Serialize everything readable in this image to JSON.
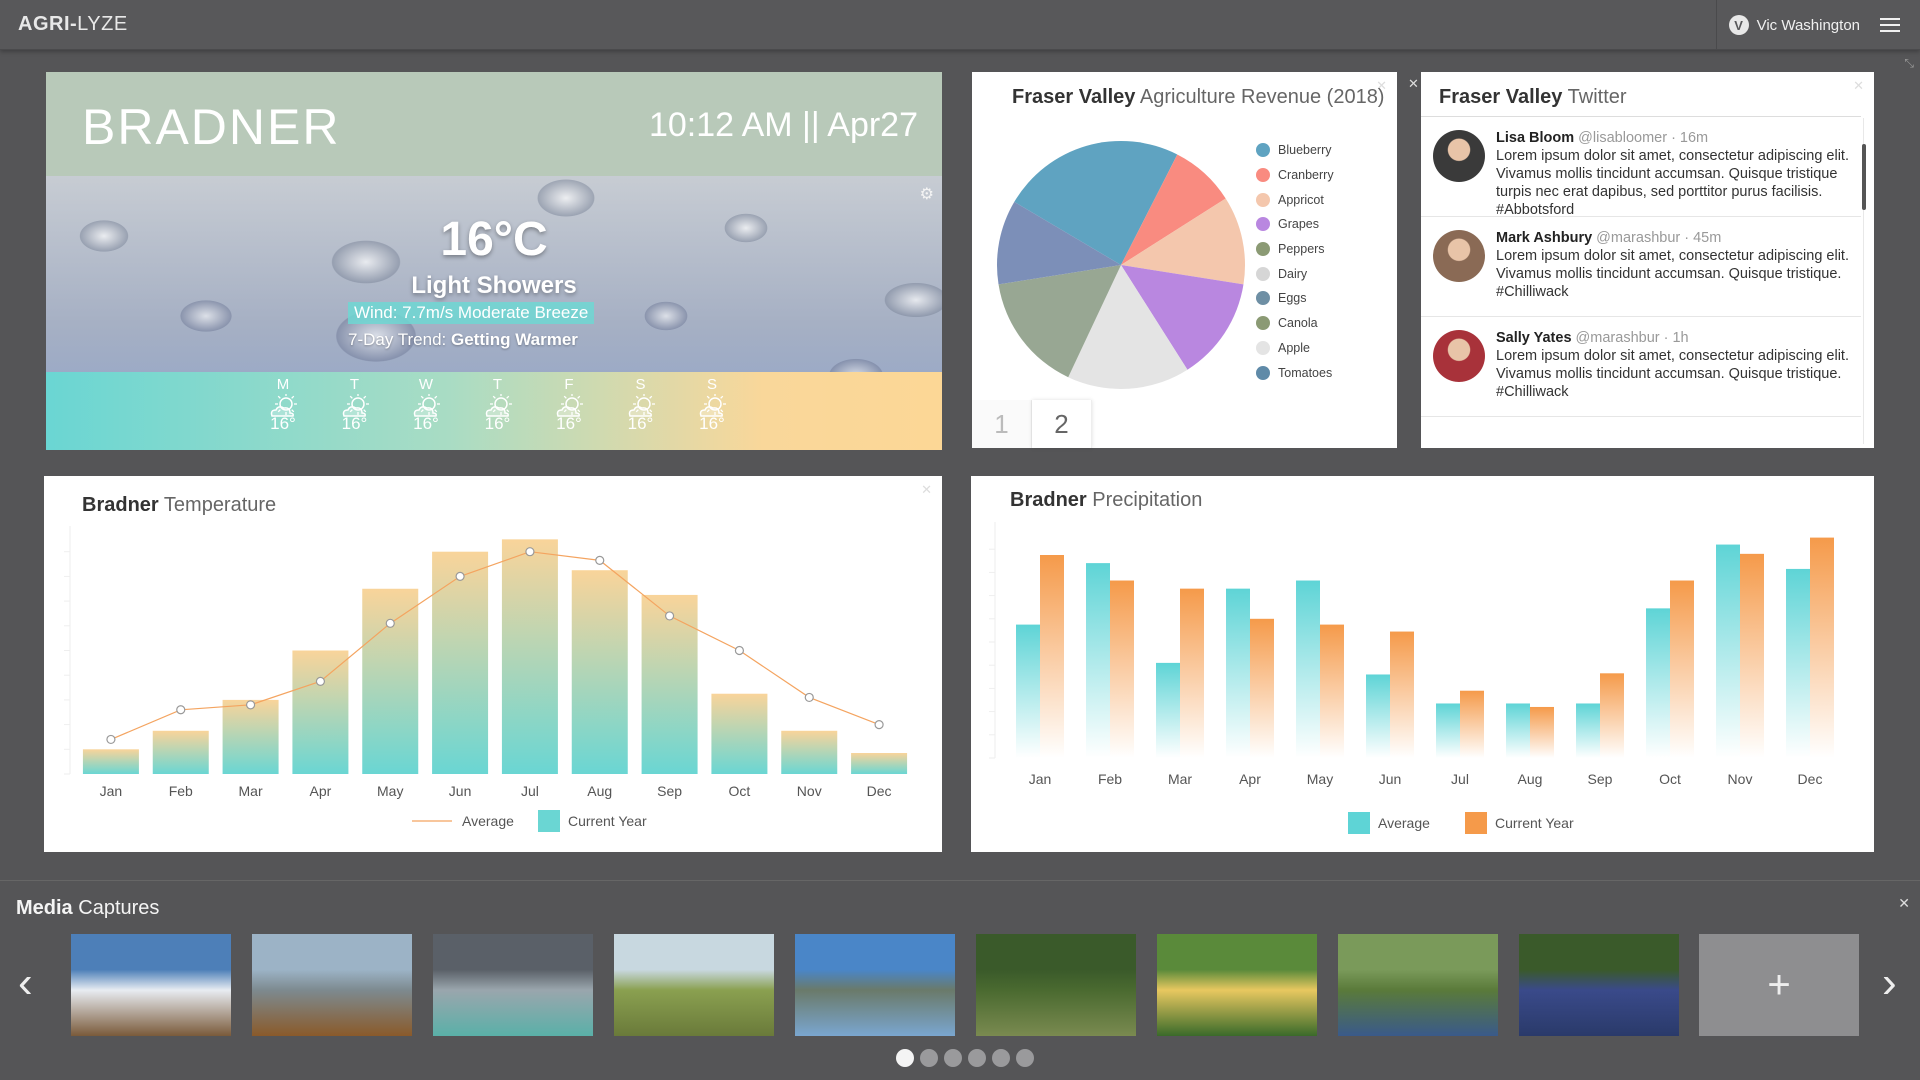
{
  "app": {
    "brand_bold": "AGRI-",
    "brand_rest": "LYZE",
    "user_name": "Vic Washington",
    "user_logo": "V"
  },
  "weather": {
    "city": "BRADNER",
    "time": "10:12 AM || Apr27",
    "temp": "16°C",
    "condition": "Light Showers",
    "wind": "Wind: 7.7m/s Moderate Breeze",
    "trend_label": "7-Day Trend:",
    "trend_value": "Getting Warmer",
    "forecast": [
      {
        "day": "M",
        "temp": "16°",
        "icon": "partly-cloudy-icon"
      },
      {
        "day": "T",
        "temp": "16°",
        "icon": "partly-cloudy-icon"
      },
      {
        "day": "W",
        "temp": "16°",
        "icon": "partly-cloudy-icon"
      },
      {
        "day": "T",
        "temp": "16°",
        "icon": "partly-cloudy-icon"
      },
      {
        "day": "F",
        "temp": "16°",
        "icon": "partly-cloudy-icon"
      },
      {
        "day": "S",
        "temp": "16°",
        "icon": "partly-cloudy-icon"
      },
      {
        "day": "S",
        "temp": "16°",
        "icon": "partly-cloudy-icon"
      }
    ]
  },
  "revenue": {
    "title_bold": "Fraser Valley",
    "title_rest": "Agriculture Revenue (2018)",
    "pages": [
      "1",
      "2"
    ],
    "active_page": "2"
  },
  "twitter": {
    "title_bold": "Fraser Valley",
    "title_rest": "Twitter",
    "tweets": [
      {
        "name": "Lisa Bloom",
        "meta": "@lisabloomer · 16m",
        "text": "Lorem ipsum dolor sit amet, consectetur adipiscing elit. Vivamus mollis tincidunt accumsan. Quisque tristique turpis nec erat dapibus, sed porttitor purus facilisis. #Abbotsford",
        "avatar_color": "#3a3a3a"
      },
      {
        "name": "Mark Ashbury",
        "meta": "@marashbur · 45m",
        "text": "Lorem ipsum dolor sit amet, consectetur adipiscing elit. Vivamus mollis tincidunt accumsan. Quisque tristique. #Chilliwack",
        "avatar_color": "#8a6a55"
      },
      {
        "name": "Sally Yates",
        "meta": "@marashbur · 1h",
        "text": "Lorem ipsum dolor sit amet, consectetur adipiscing elit. Vivamus mollis tincidunt accumsan. Quisque tristique. #Chilliwack",
        "avatar_color": "#a8323a"
      }
    ]
  },
  "temperature": {
    "title_bold": "Bradner",
    "title_rest": "Temperature"
  },
  "precipitation": {
    "title_bold": "Bradner",
    "title_rest": "Precipitation"
  },
  "media": {
    "title_bold": "Media",
    "title_rest": "Captures",
    "add_label": "+",
    "thumbnails": [
      {
        "name": "mountain-town",
        "top": "#4d7fb8",
        "mid": "#e8ecf2",
        "bottom": "#7a5a3a"
      },
      {
        "name": "valley-farm",
        "top": "#9cb3c6",
        "mid": "#7d8a8f",
        "bottom": "#8a5a2a"
      },
      {
        "name": "lake-dock",
        "top": "#5a6068",
        "mid": "#9aa6ad",
        "bottom": "#5ab0a8"
      },
      {
        "name": "grass-field",
        "top": "#c8d8e0",
        "mid": "#8aa050",
        "bottom": "#6a7a3a"
      },
      {
        "name": "mountain-lake",
        "top": "#4a86c8",
        "mid": "#6a7a6a",
        "bottom": "#7aa6d0"
      },
      {
        "name": "orchard-path",
        "top": "#3a5a2a",
        "mid": "#4a6a30",
        "bottom": "#7a8a50"
      },
      {
        "name": "girl-in-field",
        "top": "#5a8a3a",
        "mid": "#e8c860",
        "bottom": "#3a6a2a"
      },
      {
        "name": "berry-picking",
        "top": "#7a9a5a",
        "mid": "#5a7a3a",
        "bottom": "#3a5a8a"
      },
      {
        "name": "blueberries",
        "top": "#3a5a2a",
        "mid": "#3a4a8a",
        "bottom": "#2a3a6a"
      }
    ],
    "page_count": 6,
    "active_page": 0
  },
  "chart_data": [
    {
      "type": "pie",
      "title": "Fraser Valley Agriculture Revenue (2018)",
      "categories": [
        "Blueberry",
        "Cranberry",
        "Appricot",
        "Grapes",
        "Peppers",
        "Dairy",
        "Eggs",
        "Canola",
        "Apple",
        "Tomatoes"
      ],
      "colors": [
        "#5fa3c1",
        "#f98b80",
        "#f4c7ad",
        "#b987e0",
        "#8b9a74",
        "#d6d6d6",
        "#6e8fa4",
        "#8b9a74",
        "#e4e4e4",
        "#5f8aa8"
      ],
      "slices": [
        {
          "label": "Blueberry",
          "value": 24,
          "color": "#5fa3c1"
        },
        {
          "label": "Cranberry",
          "value": 8.5,
          "color": "#f98b80"
        },
        {
          "label": "Appricot",
          "value": 11.5,
          "color": "#f4c7ad"
        },
        {
          "label": "Grapes",
          "value": 13.5,
          "color": "#b987e0"
        },
        {
          "label": "Dairy",
          "value": 16,
          "color": "#e4e4e4"
        },
        {
          "label": "Peppers",
          "value": 15.5,
          "color": "#98a793"
        },
        {
          "label": "Eggs",
          "value": 11,
          "color": "#7c8fb8"
        }
      ]
    },
    {
      "type": "bar",
      "title": "Bradner Temperature",
      "categories": [
        "Jan",
        "Feb",
        "Mar",
        "Apr",
        "May",
        "Jun",
        "Jul",
        "Aug",
        "Sep",
        "Oct",
        "Nov",
        "Dec"
      ],
      "legend": [
        "Average",
        "Current Year"
      ],
      "series": [
        {
          "name": "Current Year",
          "type": "bar",
          "values": [
            2,
            3.5,
            6,
            10,
            15,
            18,
            19,
            16.5,
            14.5,
            6.5,
            3.5,
            1.7
          ]
        },
        {
          "name": "Average",
          "type": "line",
          "values": [
            2.8,
            5.2,
            5.6,
            7.5,
            12.2,
            16,
            18,
            17.3,
            12.8,
            10,
            6.2,
            4
          ]
        }
      ],
      "ylim": [
        0,
        20
      ],
      "colors": {
        "bar_top": "#f9d49a",
        "bar_bottom": "#6ad6d3",
        "line": "#f4a460"
      }
    },
    {
      "type": "bar",
      "title": "Bradner Precipitation",
      "categories": [
        "Jan",
        "Feb",
        "Mar",
        "Apr",
        "May",
        "Jun",
        "Jul",
        "Aug",
        "Sep",
        "Oct",
        "Nov",
        "Dec"
      ],
      "legend": [
        "Average",
        "Current Year"
      ],
      "series": [
        {
          "name": "Average",
          "values": [
            115,
            168,
            82,
            146,
            153,
            72,
            47,
            47,
            47,
            129,
            184,
            163
          ]
        },
        {
          "name": "Current Year",
          "values": [
            175,
            153,
            146,
            120,
            115,
            109,
            58,
            44,
            73,
            153,
            176,
            190
          ]
        }
      ],
      "ylim": [
        0,
        200
      ],
      "colors": {
        "Average": "#5ed4d6",
        "Current Year": "#f59a4a"
      }
    }
  ]
}
